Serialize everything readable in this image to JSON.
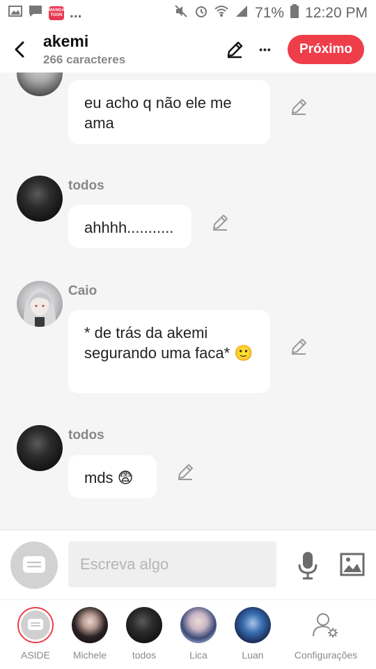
{
  "status_bar": {
    "notification_dots": "...",
    "manga_badge": "MANGA TOON",
    "battery": "71%",
    "time": "12:20 PM"
  },
  "header": {
    "title": "akemi",
    "subtitle": "266 caracteres",
    "next_button": "Próximo",
    "more": "•••"
  },
  "messages": [
    {
      "sender": "",
      "text": "eu acho q não ele me ama",
      "avatar": "dark-character-avatar"
    },
    {
      "sender": "todos",
      "text": "ahhhh...........",
      "avatar": "dark-character-avatar"
    },
    {
      "sender": "Caio",
      "text": "* de trás da akemi segurando uma faca* 🙂",
      "avatar": "silver-hair-character-avatar"
    },
    {
      "sender": "todos",
      "text": "mds 😨",
      "avatar": "dark-character-avatar"
    }
  ],
  "composer": {
    "placeholder": "Escreva algo"
  },
  "tabs": [
    {
      "label": "ASIDE",
      "icon": "chat-bubble-icon"
    },
    {
      "label": "Michele",
      "icon": "avatar"
    },
    {
      "label": "todos",
      "icon": "avatar"
    },
    {
      "label": "Lica",
      "icon": "avatar"
    },
    {
      "label": "Luan",
      "icon": "avatar"
    },
    {
      "label": "Configurações",
      "icon": "user-gear-icon"
    }
  ],
  "colors": {
    "accent": "#ee3e49",
    "background": "#f5f5f5",
    "bubble": "#ffffff",
    "muted_text": "#888888"
  }
}
